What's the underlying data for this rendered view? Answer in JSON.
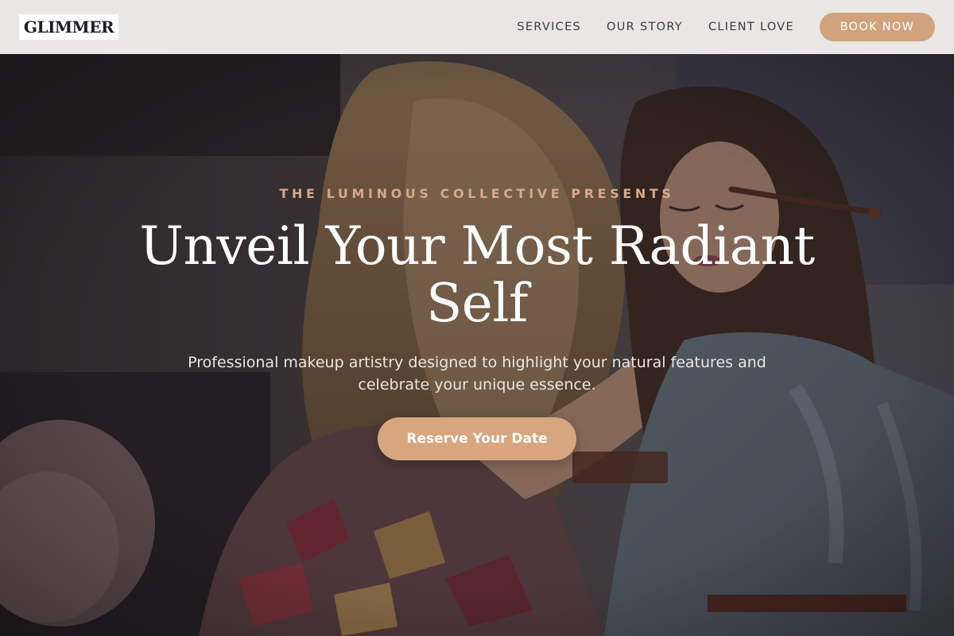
{
  "header": {
    "logo_text": "GLIMMER",
    "nav": [
      {
        "label": "SERVICES"
      },
      {
        "label": "OUR STORY"
      },
      {
        "label": "CLIENT LOVE"
      }
    ],
    "book_label": "BOOK NOW"
  },
  "hero": {
    "eyebrow": "THE LUMINOUS COLLECTIVE PRESENTS",
    "headline": "Unveil Your Most Radiant Self",
    "subtext": "Professional makeup artistry designed to highlight your natural features and celebrate your unique essence.",
    "cta_label": "Reserve Your Date"
  },
  "colors": {
    "accent": "#d8a67e",
    "eyebrow": "#d9a88a",
    "header_bg": "#e8e7e5"
  }
}
